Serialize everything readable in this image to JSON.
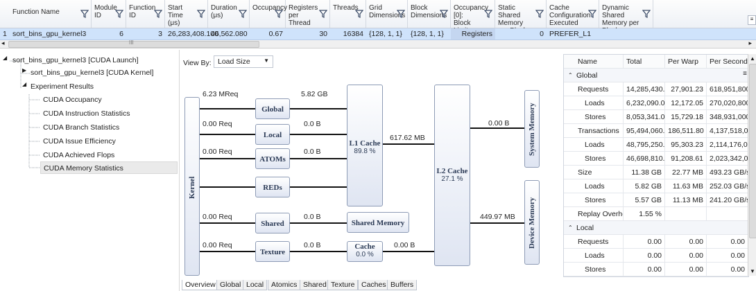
{
  "grid": {
    "columns": [
      {
        "label": "Function Name"
      },
      {
        "label": "Module ID"
      },
      {
        "label": "Function ID"
      },
      {
        "label": "Start Time (μs)"
      },
      {
        "label": "Duration (μs)"
      },
      {
        "label": "Occupancy"
      },
      {
        "label": "Registers per Thread"
      },
      {
        "label": "Threads"
      },
      {
        "label": "Grid Dimensions"
      },
      {
        "label": "Block Dimensions"
      },
      {
        "label": "Occupancy [0]: Block Limit Reason"
      },
      {
        "label": "Static Shared Memory per Block (bytes)"
      },
      {
        "label": "Cache Configuration Executed"
      },
      {
        "label": "Dynamic Shared Memory per Block (bytes)"
      }
    ],
    "row": {
      "index": "1",
      "cells": [
        "sort_bins_gpu_kernel3",
        "6",
        "3",
        "26,283,408.100",
        "46,562.080",
        "0.67",
        "30",
        "16384",
        "{128, 1, 1}",
        "{128, 1, 1}",
        "Registers",
        "0",
        "PREFER_L1",
        ""
      ]
    },
    "scroll_glyph": "III"
  },
  "tree": {
    "items": [
      {
        "label": "sort_bins_gpu_kernel3 [CUDA Launch]"
      },
      {
        "label": "sort_bins_gpu_kernel3 [CUDA Kernel]"
      },
      {
        "label": "Experiment Results"
      },
      {
        "label": "CUDA Occupancy"
      },
      {
        "label": "CUDA Instruction Statistics"
      },
      {
        "label": "CUDA Branch Statistics"
      },
      {
        "label": "CUDA Issue Efficiency"
      },
      {
        "label": "CUDA Achieved Flops"
      },
      {
        "label": "CUDA Memory Statistics"
      }
    ]
  },
  "view_by": {
    "label": "View By:",
    "value": "Load Size"
  },
  "diagram": {
    "kernel": "Kernel",
    "global": "Global",
    "local": "Local",
    "atoms": "ATOMs",
    "reds": "REDs",
    "shared": "Shared",
    "texture": "Texture",
    "l1_title": "L1 Cache",
    "l1_pct": "89.8 %",
    "l2_title": "L2 Cache",
    "l2_pct": "27.1 %",
    "shared_memory": "Shared Memory",
    "tex_cache_title": "Cache",
    "tex_cache_pct": "0.0 %",
    "system_memory": "System Memory",
    "device_memory": "Device Memory",
    "req_global": "6.23 MReq",
    "req_local": "0.00 Req",
    "req_atoms": "0.00 Req",
    "req_shared": "0.00 Req",
    "req_texture": "0.00 Req",
    "bytes_global": "5.82 GB",
    "bytes_local": "0.0 B",
    "bytes_atoms": "0.0 B",
    "bytes_shared": "0.0 B",
    "bytes_texture": "0.0 B",
    "bytes_texcache": "0.00 B",
    "l1_l2": "617.62 MB",
    "l2_sys": "0.00 B",
    "l2_dev": "449.97 MB"
  },
  "tabs": [
    "Overview",
    "Global",
    "Local",
    "Atomics",
    "Shared",
    "Texture",
    "Caches",
    "Buffers"
  ],
  "stats": {
    "headers": [
      "Name",
      "Total",
      "Per Warp",
      "Per Second"
    ],
    "rows": [
      {
        "type": "group",
        "name": "Global"
      },
      {
        "name": "Requests",
        "total": "14,285,430.0",
        "warp": "27,901.23",
        "sec": "618,951,800."
      },
      {
        "name": "Loads",
        "total": "6,232,090.00",
        "warp": "12,172.05",
        "sec": "270,020,800.",
        "indent": true
      },
      {
        "name": "Stores",
        "total": "8,053,341.00",
        "warp": "15,729.18",
        "sec": "348,931,000.",
        "indent": true
      },
      {
        "name": "Transactions",
        "total": "95,494,060.0",
        "warp": "186,511.80",
        "sec": "4,137,518,00"
      },
      {
        "name": "Loads",
        "total": "48,795,250.0",
        "warp": "95,303.23",
        "sec": "2,114,176,00",
        "indent": true
      },
      {
        "name": "Stores",
        "total": "46,698,810.0",
        "warp": "91,208.61",
        "sec": "2,023,342,00",
        "indent": true
      },
      {
        "name": "Size",
        "total": "11.38 GB",
        "warp": "22.77 MB",
        "sec": "493.23 GB/s"
      },
      {
        "name": "Loads",
        "total": "5.82 GB",
        "warp": "11.63 MB",
        "sec": "252.03 GB/s",
        "indent": true
      },
      {
        "name": "Stores",
        "total": "5.57 GB",
        "warp": "11.13 MB",
        "sec": "241.20 GB/s",
        "indent": true
      },
      {
        "name": "Replay Overhead",
        "total": "1.55 %",
        "warp": "",
        "sec": ""
      },
      {
        "type": "group",
        "name": "Local"
      },
      {
        "name": "Requests",
        "total": "0.00",
        "warp": "0.00",
        "sec": "0.00"
      },
      {
        "name": "Loads",
        "total": "0.00",
        "warp": "0.00",
        "sec": "0.00",
        "indent": true
      },
      {
        "name": "Stores",
        "total": "0.00",
        "warp": "0.00",
        "sec": "0.00",
        "indent": true
      }
    ]
  }
}
